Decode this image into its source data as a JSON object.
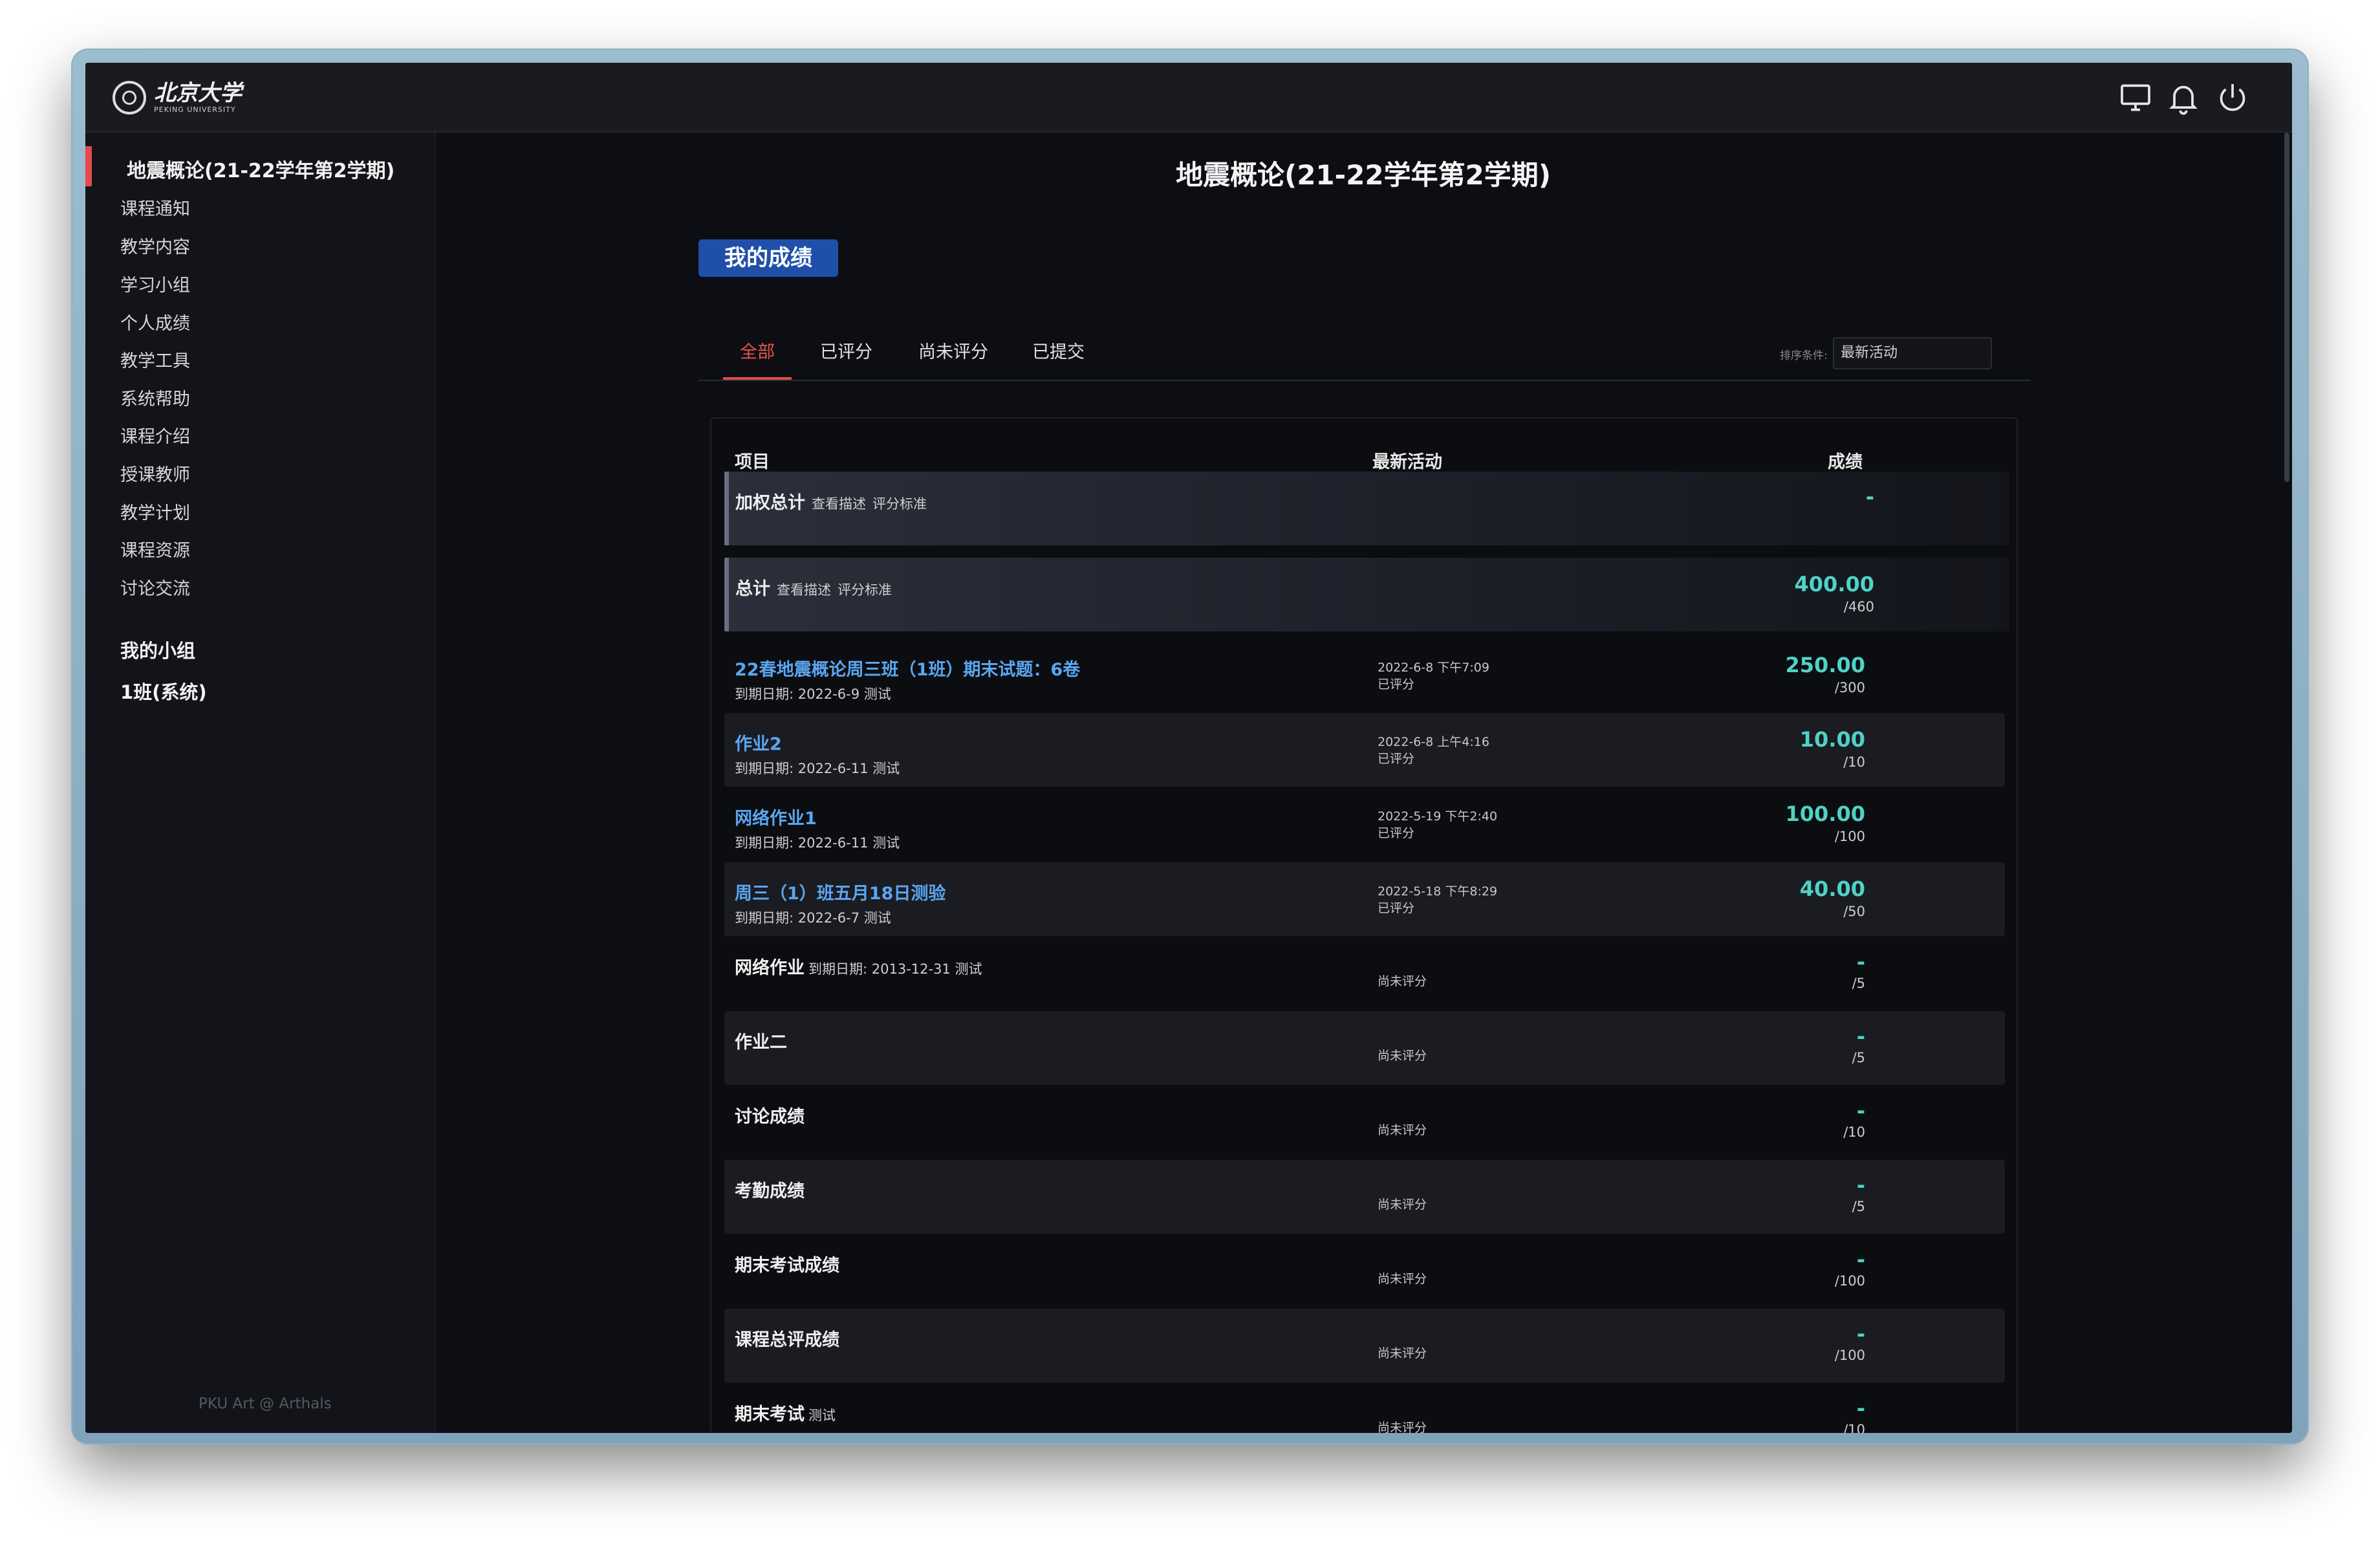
{
  "brand": {
    "name_cn": "北京大学",
    "name_en": "PEKING UNIVERSITY"
  },
  "topbar": {
    "icons": [
      "monitor-icon",
      "bell-icon",
      "power-icon"
    ]
  },
  "sidebar": {
    "course": "地震概论(21-22学年第2学期)",
    "items": [
      "课程通知",
      "教学内容",
      "学习小组",
      "个人成绩",
      "教学工具",
      "系统帮助",
      "课程介绍",
      "授课教师",
      "教学计划",
      "课程资源",
      "讨论交流"
    ],
    "groups_title": "我的小组",
    "group_item": "1班(系统)",
    "footer": "PKU Art @ Arthals"
  },
  "main": {
    "title": "地震概论(21-22学年第2学期)",
    "section_badge": "我的成绩",
    "tabs": [
      "全部",
      "已评分",
      "尚未评分",
      "已提交"
    ],
    "active_tab": "全部",
    "sort_label": "排序条件:",
    "sort_value": "最新活动"
  },
  "table": {
    "headers": {
      "item": "项目",
      "activity": "最新活动",
      "score": "成绩"
    },
    "summary_rows": [
      {
        "title": "加权总计",
        "links": [
          "查看描述",
          "评分标准"
        ],
        "score": "-",
        "max": ""
      },
      {
        "title": "总计",
        "links": [
          "查看描述",
          "评分标准"
        ],
        "score": "400.00",
        "max": "/460"
      }
    ],
    "rows": [
      {
        "title": "22春地震概论周三班（1班）期末试题：6卷",
        "link": true,
        "sub": "到期日期: 2022-6-9    测试",
        "time": "2022-6-8 下午7:09",
        "status": "已评分",
        "score": "250.00",
        "max": "/300"
      },
      {
        "title": "作业2",
        "link": true,
        "sub": "到期日期: 2022-6-11    测试",
        "time": "2022-6-8 上午4:16",
        "status": "已评分",
        "score": "10.00",
        "max": "/10"
      },
      {
        "title": "网络作业1",
        "link": true,
        "sub": "到期日期: 2022-6-11    测试",
        "time": "2022-5-19 下午2:40",
        "status": "已评分",
        "score": "100.00",
        "max": "/100"
      },
      {
        "title": "周三（1）班五月18日测验",
        "link": true,
        "sub": "到期日期: 2022-6-7    测试",
        "time": "2022-5-18 下午8:29",
        "status": "已评分",
        "score": "40.00",
        "max": "/50"
      },
      {
        "title": "网络作业",
        "link": false,
        "inline": "到期日期: 2013-12-31    测试",
        "sub": "",
        "time": "",
        "status": "尚未评分",
        "score": "-",
        "max": "/5"
      },
      {
        "title": "作业二",
        "link": false,
        "sub": "",
        "time": "",
        "status": "尚未评分",
        "score": "-",
        "max": "/5"
      },
      {
        "title": "讨论成绩",
        "link": false,
        "sub": "",
        "time": "",
        "status": "尚未评分",
        "score": "-",
        "max": "/10"
      },
      {
        "title": "考勤成绩",
        "link": false,
        "sub": "",
        "time": "",
        "status": "尚未评分",
        "score": "-",
        "max": "/5"
      },
      {
        "title": "期末考试成绩",
        "link": false,
        "sub": "",
        "time": "",
        "status": "尚未评分",
        "score": "-",
        "max": "/100"
      },
      {
        "title": "课程总评成绩",
        "link": false,
        "sub": "",
        "time": "",
        "status": "尚未评分",
        "score": "-",
        "max": "/100"
      },
      {
        "title": "期末考试",
        "link": false,
        "inline": "测试",
        "sub": "",
        "time": "",
        "status": "尚未评分",
        "score": "-",
        "max": "/10"
      }
    ]
  },
  "colors": {
    "accent_red": "#e34b4b",
    "link_blue": "#5aa6f0",
    "score_teal": "#4fd2c6",
    "badge_blue": "#1f4fa8"
  }
}
